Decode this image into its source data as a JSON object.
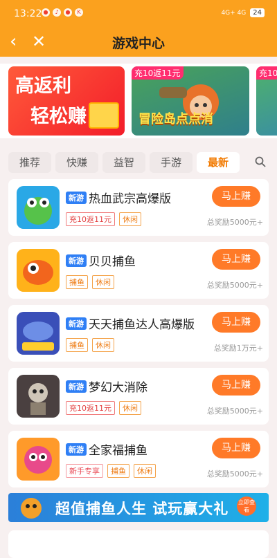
{
  "status": {
    "time": "13:22",
    "battery": "24",
    "net": "4G+ 4G"
  },
  "header": {
    "title": "游戏中心"
  },
  "banners": [
    {
      "line1": "高返利",
      "line2": "轻松赚"
    },
    {
      "badge": "充10返11元",
      "title": "冒险岛点点消"
    },
    {
      "badge": "充10"
    }
  ],
  "tabs": [
    {
      "label": "推荐",
      "active": false
    },
    {
      "label": "快赚",
      "active": false
    },
    {
      "label": "益智",
      "active": false
    },
    {
      "label": "手游",
      "active": false
    },
    {
      "label": "最新",
      "active": true
    }
  ],
  "games": [
    {
      "tag": "新游",
      "name": "热血武宗高爆版",
      "labels": [
        "充10返11元",
        "休闲"
      ],
      "button": "马上赚",
      "prize": "总奖励5000元+"
    },
    {
      "tag": "新游",
      "name": "贝贝捕鱼",
      "labels": [
        "捕鱼",
        "休闲"
      ],
      "button": "马上赚",
      "prize": "总奖励5000元+"
    },
    {
      "tag": "新游",
      "name": "天天捕鱼达人高爆版",
      "labels": [
        "捕鱼",
        "休闲"
      ],
      "button": "马上赚",
      "prize": "总奖励1万元+"
    },
    {
      "tag": "新游",
      "name": "梦幻大消除",
      "labels": [
        "充10返11元",
        "休闲"
      ],
      "button": "马上赚",
      "prize": "总奖励5000元+"
    },
    {
      "tag": "新游",
      "name": "全家福捕鱼",
      "labels": [
        "新手专享",
        "捕鱼",
        "休闲"
      ],
      "button": "马上赚",
      "prize": "总奖励5000元+"
    }
  ],
  "promo": {
    "text": "超值捕鱼人生 试玩赢大礼",
    "button": "立即查看"
  }
}
